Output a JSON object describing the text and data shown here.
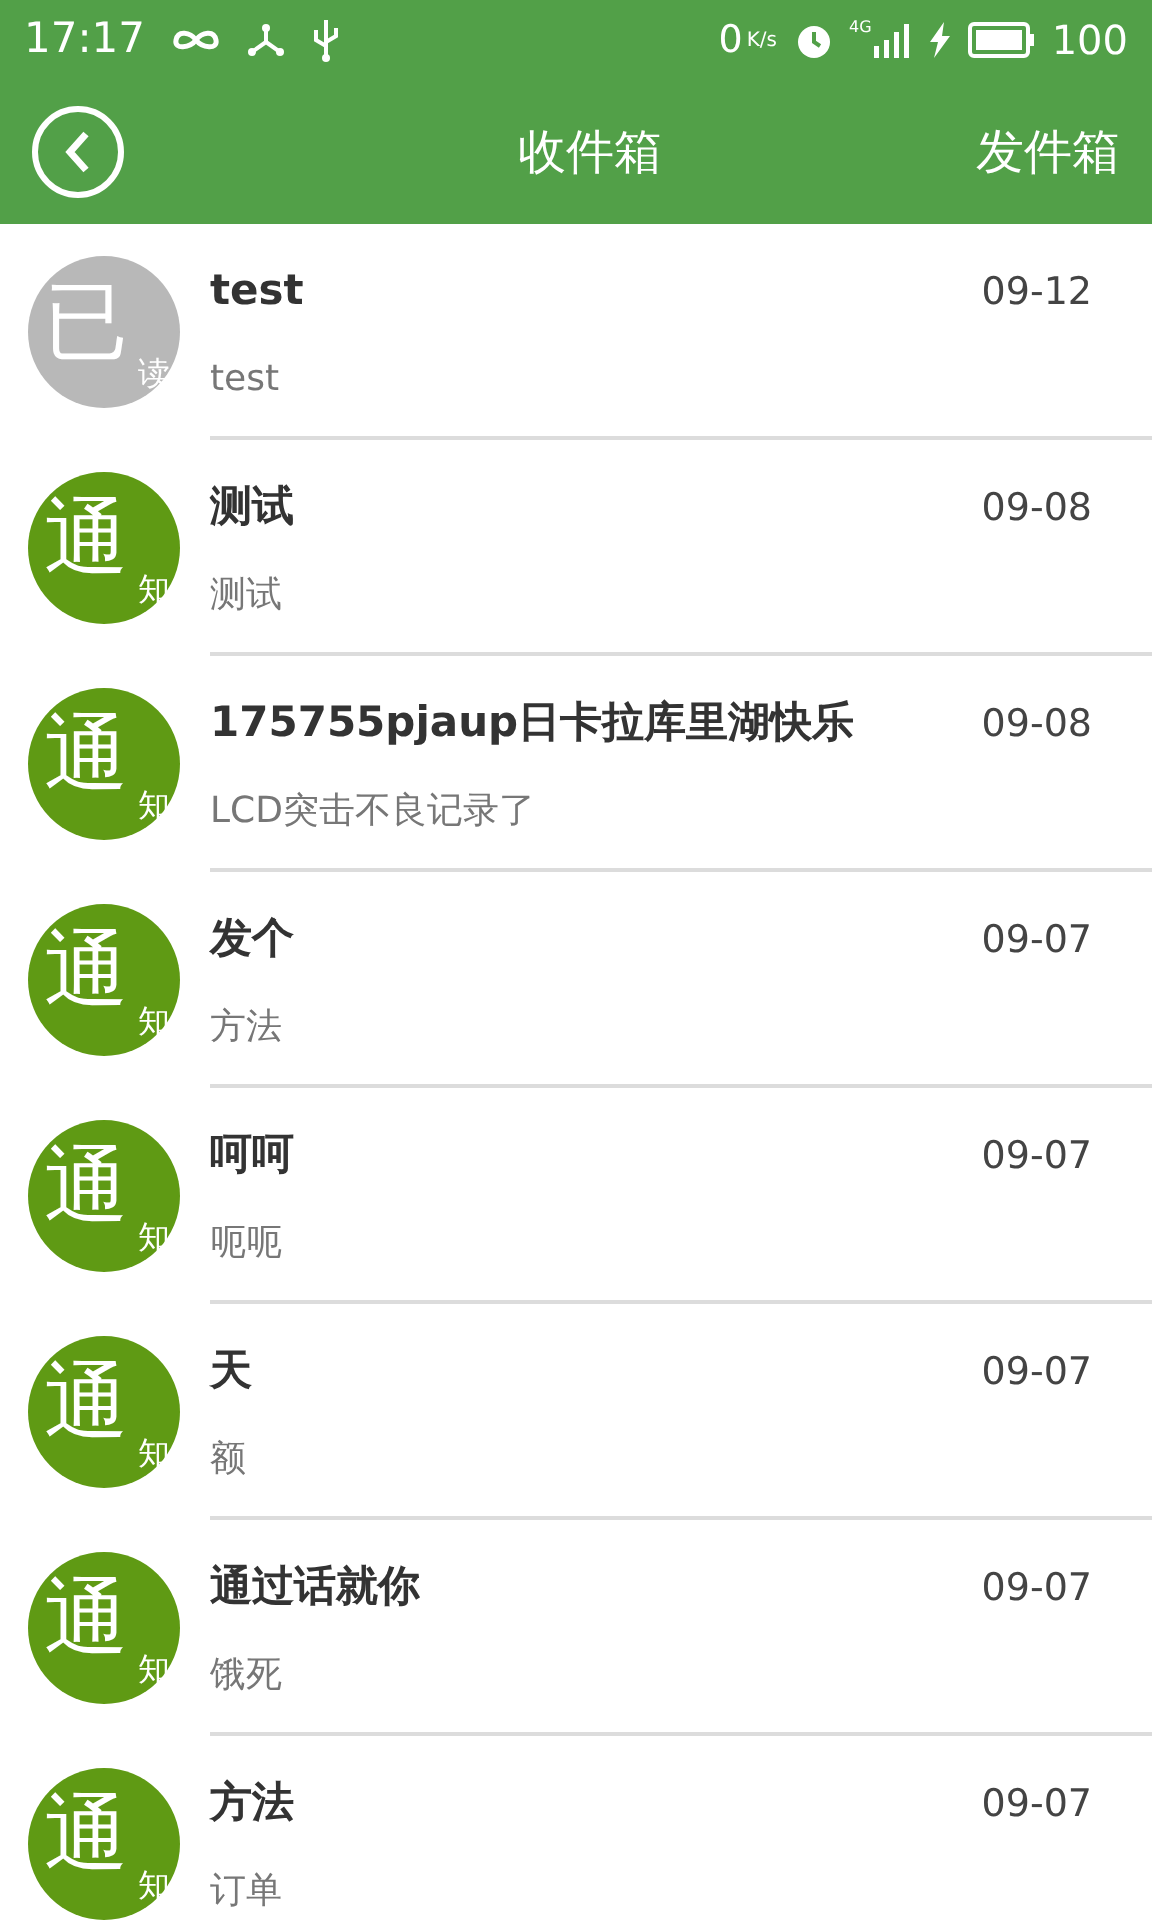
{
  "status_bar": {
    "time": "17:17",
    "speed": "0",
    "speed_unit": "K/s",
    "network": "4G",
    "battery": "100"
  },
  "header": {
    "title": "收件箱",
    "action": "发件箱"
  },
  "messages": [
    {
      "avatar_main": "已",
      "avatar_sub": "读",
      "read": true,
      "title": "test",
      "preview": "test",
      "date": "09-12"
    },
    {
      "avatar_main": "通",
      "avatar_sub": "知",
      "read": false,
      "title": "测试",
      "preview": "测试",
      "date": "09-08"
    },
    {
      "avatar_main": "通",
      "avatar_sub": "知",
      "read": false,
      "title": "175755pjaup日卡拉库里湖快乐",
      "preview": "LCD突击不良记录了",
      "date": "09-08"
    },
    {
      "avatar_main": "通",
      "avatar_sub": "知",
      "read": false,
      "title": "发个",
      "preview": "方法",
      "date": "09-07"
    },
    {
      "avatar_main": "通",
      "avatar_sub": "知",
      "read": false,
      "title": "呵呵",
      "preview": "呃呃",
      "date": "09-07"
    },
    {
      "avatar_main": "通",
      "avatar_sub": "知",
      "read": false,
      "title": "天",
      "preview": "额",
      "date": "09-07"
    },
    {
      "avatar_main": "通",
      "avatar_sub": "知",
      "read": false,
      "title": "通过话就你",
      "preview": "饿死",
      "date": "09-07"
    },
    {
      "avatar_main": "通",
      "avatar_sub": "知",
      "read": false,
      "title": "方法",
      "preview": "订单",
      "date": "09-07"
    }
  ]
}
